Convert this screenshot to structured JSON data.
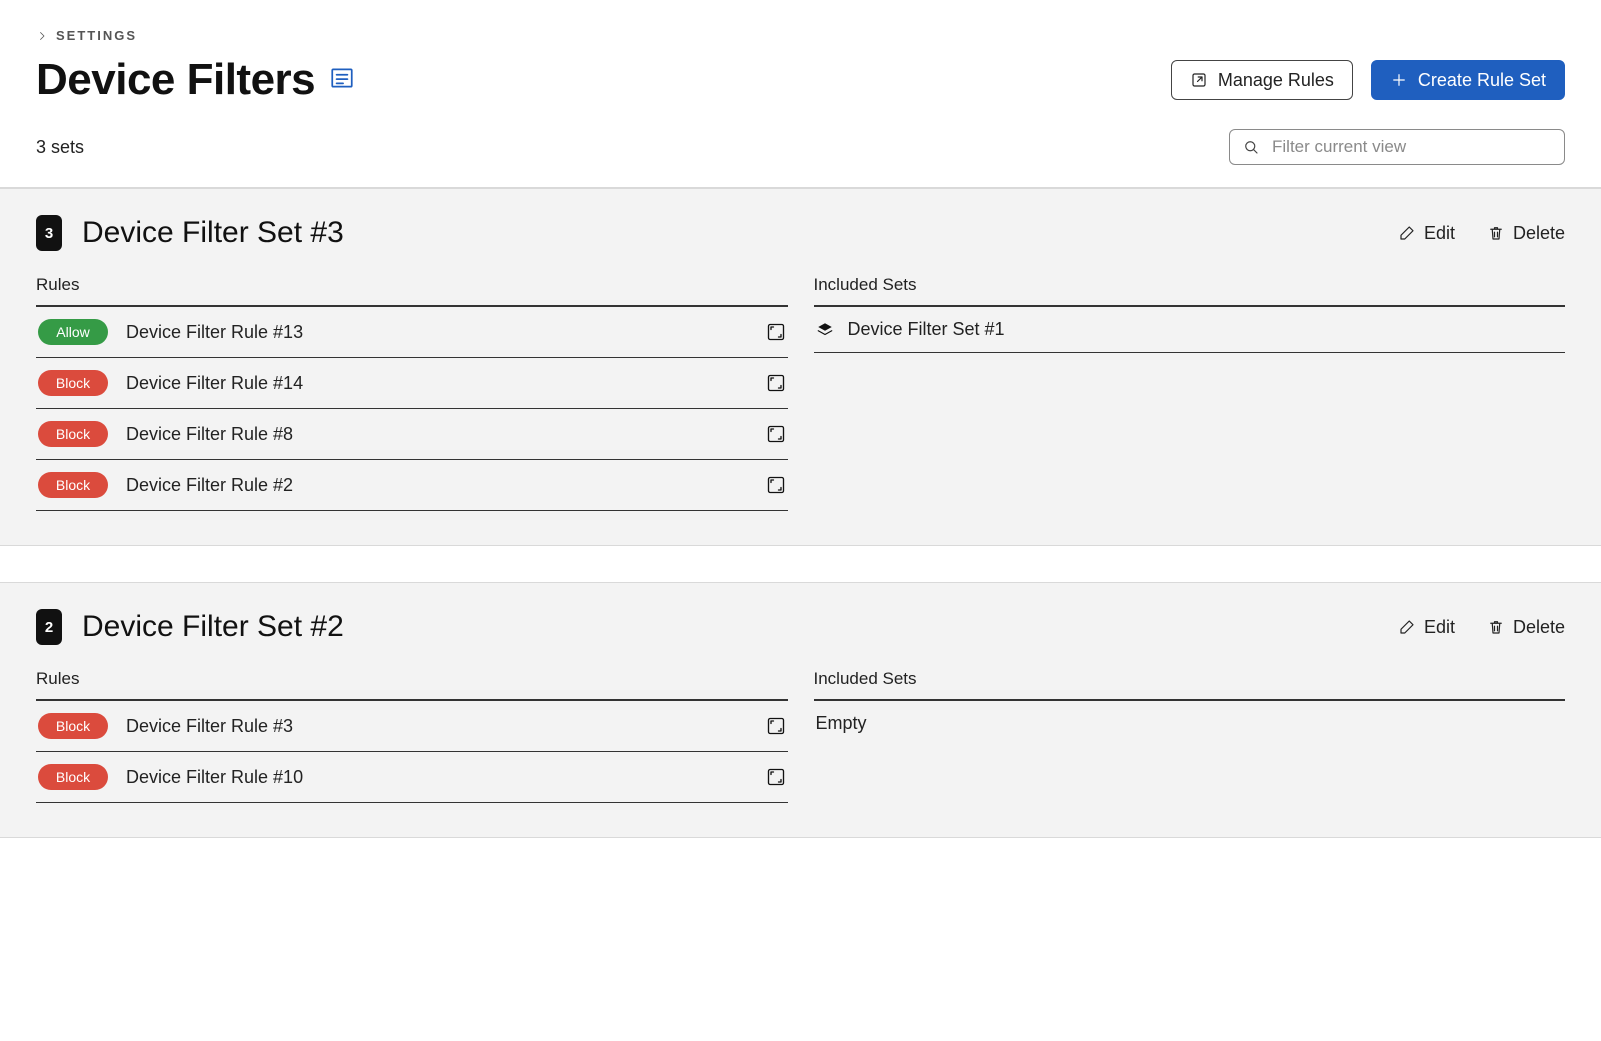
{
  "breadcrumb": {
    "label": "Settings"
  },
  "page_title": "Device Filters",
  "actions": {
    "manage_rules": "Manage Rules",
    "create_rule_set": "Create Rule Set"
  },
  "count_text": "3 sets",
  "search": {
    "placeholder": "Filter current view"
  },
  "section_labels": {
    "rules": "Rules",
    "included_sets": "Included Sets",
    "edit": "Edit",
    "delete": "Delete",
    "empty": "Empty"
  },
  "badge_labels": {
    "allow": "Allow",
    "block": "Block"
  },
  "sets": [
    {
      "order": "3",
      "title": "Device Filter Set #3",
      "rules": [
        {
          "type": "allow",
          "label": "Device Filter Rule #13"
        },
        {
          "type": "block",
          "label": "Device Filter Rule #14"
        },
        {
          "type": "block",
          "label": "Device Filter Rule #8"
        },
        {
          "type": "block",
          "label": "Device Filter Rule #2"
        }
      ],
      "included": [
        {
          "label": "Device Filter Set #1"
        }
      ]
    },
    {
      "order": "2",
      "title": "Device Filter Set #2",
      "rules": [
        {
          "type": "block",
          "label": "Device Filter Rule #3"
        },
        {
          "type": "block",
          "label": "Device Filter Rule #10"
        }
      ],
      "included": []
    }
  ]
}
